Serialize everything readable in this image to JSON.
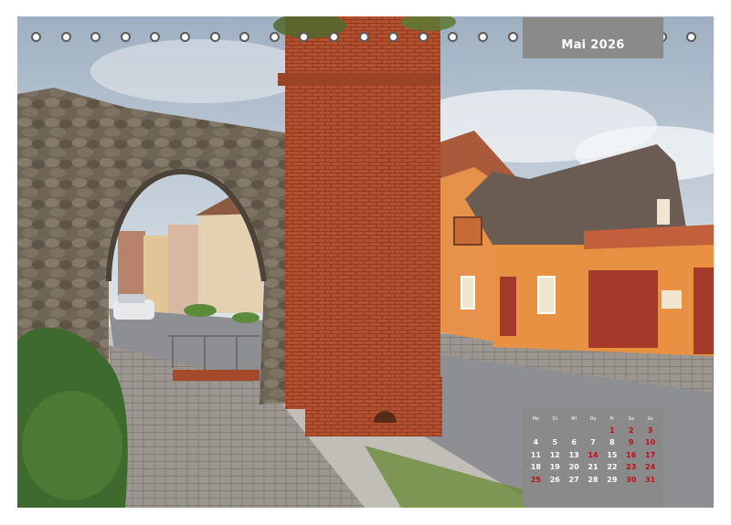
{
  "calendar": {
    "month_label": "Mai 2026",
    "weekdays": [
      "Mo",
      "Di",
      "Mi",
      "Do",
      "Fr",
      "Sa",
      "So"
    ],
    "weeks": [
      [
        "",
        "",
        "",
        "",
        "1",
        "2",
        "3"
      ],
      [
        "4",
        "5",
        "6",
        "7",
        "8",
        "9",
        "10"
      ],
      [
        "11",
        "12",
        "13",
        "14",
        "15",
        "16",
        "17"
      ],
      [
        "18",
        "19",
        "20",
        "21",
        "22",
        "23",
        "24"
      ],
      [
        "25",
        "26",
        "27",
        "28",
        "29",
        "30",
        "31"
      ]
    ],
    "highlighted_days": [
      "1",
      "2",
      "3",
      "9",
      "10",
      "14",
      "16",
      "17",
      "23",
      "24",
      "25",
      "30",
      "31"
    ],
    "highlight_color": "#c40a1a"
  },
  "binding": {
    "ring_count": 23
  },
  "photo": {
    "alt": ""
  }
}
